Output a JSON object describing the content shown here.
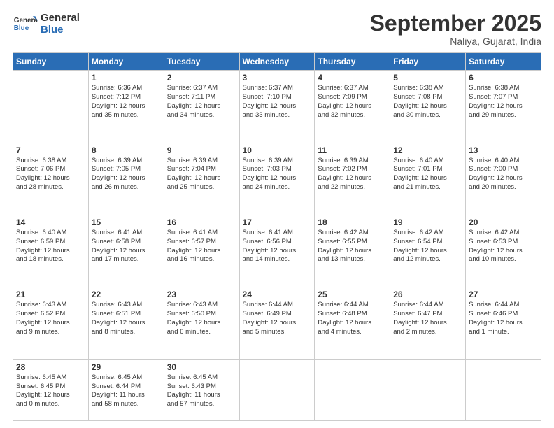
{
  "logo": {
    "line1": "General",
    "line2": "Blue"
  },
  "header": {
    "title": "September 2025",
    "location": "Naliya, Gujarat, India"
  },
  "weekdays": [
    "Sunday",
    "Monday",
    "Tuesday",
    "Wednesday",
    "Thursday",
    "Friday",
    "Saturday"
  ],
  "weeks": [
    [
      {
        "day": "",
        "info": ""
      },
      {
        "day": "1",
        "info": "Sunrise: 6:36 AM\nSunset: 7:12 PM\nDaylight: 12 hours\nand 35 minutes."
      },
      {
        "day": "2",
        "info": "Sunrise: 6:37 AM\nSunset: 7:11 PM\nDaylight: 12 hours\nand 34 minutes."
      },
      {
        "day": "3",
        "info": "Sunrise: 6:37 AM\nSunset: 7:10 PM\nDaylight: 12 hours\nand 33 minutes."
      },
      {
        "day": "4",
        "info": "Sunrise: 6:37 AM\nSunset: 7:09 PM\nDaylight: 12 hours\nand 32 minutes."
      },
      {
        "day": "5",
        "info": "Sunrise: 6:38 AM\nSunset: 7:08 PM\nDaylight: 12 hours\nand 30 minutes."
      },
      {
        "day": "6",
        "info": "Sunrise: 6:38 AM\nSunset: 7:07 PM\nDaylight: 12 hours\nand 29 minutes."
      }
    ],
    [
      {
        "day": "7",
        "info": "Sunrise: 6:38 AM\nSunset: 7:06 PM\nDaylight: 12 hours\nand 28 minutes."
      },
      {
        "day": "8",
        "info": "Sunrise: 6:39 AM\nSunset: 7:05 PM\nDaylight: 12 hours\nand 26 minutes."
      },
      {
        "day": "9",
        "info": "Sunrise: 6:39 AM\nSunset: 7:04 PM\nDaylight: 12 hours\nand 25 minutes."
      },
      {
        "day": "10",
        "info": "Sunrise: 6:39 AM\nSunset: 7:03 PM\nDaylight: 12 hours\nand 24 minutes."
      },
      {
        "day": "11",
        "info": "Sunrise: 6:39 AM\nSunset: 7:02 PM\nDaylight: 12 hours\nand 22 minutes."
      },
      {
        "day": "12",
        "info": "Sunrise: 6:40 AM\nSunset: 7:01 PM\nDaylight: 12 hours\nand 21 minutes."
      },
      {
        "day": "13",
        "info": "Sunrise: 6:40 AM\nSunset: 7:00 PM\nDaylight: 12 hours\nand 20 minutes."
      }
    ],
    [
      {
        "day": "14",
        "info": "Sunrise: 6:40 AM\nSunset: 6:59 PM\nDaylight: 12 hours\nand 18 minutes."
      },
      {
        "day": "15",
        "info": "Sunrise: 6:41 AM\nSunset: 6:58 PM\nDaylight: 12 hours\nand 17 minutes."
      },
      {
        "day": "16",
        "info": "Sunrise: 6:41 AM\nSunset: 6:57 PM\nDaylight: 12 hours\nand 16 minutes."
      },
      {
        "day": "17",
        "info": "Sunrise: 6:41 AM\nSunset: 6:56 PM\nDaylight: 12 hours\nand 14 minutes."
      },
      {
        "day": "18",
        "info": "Sunrise: 6:42 AM\nSunset: 6:55 PM\nDaylight: 12 hours\nand 13 minutes."
      },
      {
        "day": "19",
        "info": "Sunrise: 6:42 AM\nSunset: 6:54 PM\nDaylight: 12 hours\nand 12 minutes."
      },
      {
        "day": "20",
        "info": "Sunrise: 6:42 AM\nSunset: 6:53 PM\nDaylight: 12 hours\nand 10 minutes."
      }
    ],
    [
      {
        "day": "21",
        "info": "Sunrise: 6:43 AM\nSunset: 6:52 PM\nDaylight: 12 hours\nand 9 minutes."
      },
      {
        "day": "22",
        "info": "Sunrise: 6:43 AM\nSunset: 6:51 PM\nDaylight: 12 hours\nand 8 minutes."
      },
      {
        "day": "23",
        "info": "Sunrise: 6:43 AM\nSunset: 6:50 PM\nDaylight: 12 hours\nand 6 minutes."
      },
      {
        "day": "24",
        "info": "Sunrise: 6:44 AM\nSunset: 6:49 PM\nDaylight: 12 hours\nand 5 minutes."
      },
      {
        "day": "25",
        "info": "Sunrise: 6:44 AM\nSunset: 6:48 PM\nDaylight: 12 hours\nand 4 minutes."
      },
      {
        "day": "26",
        "info": "Sunrise: 6:44 AM\nSunset: 6:47 PM\nDaylight: 12 hours\nand 2 minutes."
      },
      {
        "day": "27",
        "info": "Sunrise: 6:44 AM\nSunset: 6:46 PM\nDaylight: 12 hours\nand 1 minute."
      }
    ],
    [
      {
        "day": "28",
        "info": "Sunrise: 6:45 AM\nSunset: 6:45 PM\nDaylight: 12 hours\nand 0 minutes."
      },
      {
        "day": "29",
        "info": "Sunrise: 6:45 AM\nSunset: 6:44 PM\nDaylight: 11 hours\nand 58 minutes."
      },
      {
        "day": "30",
        "info": "Sunrise: 6:45 AM\nSunset: 6:43 PM\nDaylight: 11 hours\nand 57 minutes."
      },
      {
        "day": "",
        "info": ""
      },
      {
        "day": "",
        "info": ""
      },
      {
        "day": "",
        "info": ""
      },
      {
        "day": "",
        "info": ""
      }
    ]
  ]
}
